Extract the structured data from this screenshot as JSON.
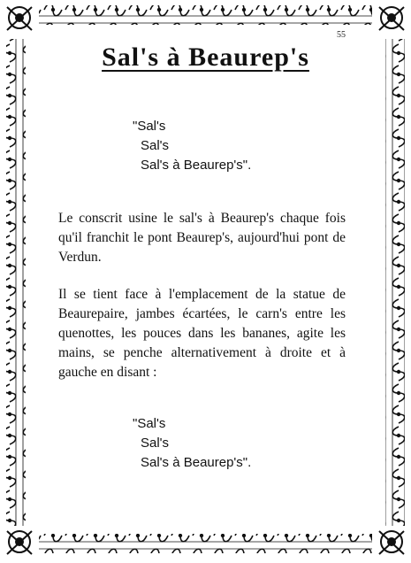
{
  "page_number": "55",
  "title": "Sal's à Beaurep's",
  "verse_top": [
    "\"Sal's",
    "Sal's",
    "Sal's à Beaurep's\"."
  ],
  "paragraph_1": "Le conscrit usine le sal's à Beaurep's chaque fois qu'il franchit le pont Beaurep's, aujourd'hui pont de Verdun.",
  "paragraph_2": "Il se tient face à l'emplacement de la statue de Beaurepaire, jambes écartées, le carn's entre les quenottes, les pouces dans les bananes, agite les mains, se penche alternativement à droite et à gauche en disant :",
  "verse_bottom": [
    "\"Sal's",
    "Sal's",
    "Sal's à Beaurep's\"."
  ]
}
